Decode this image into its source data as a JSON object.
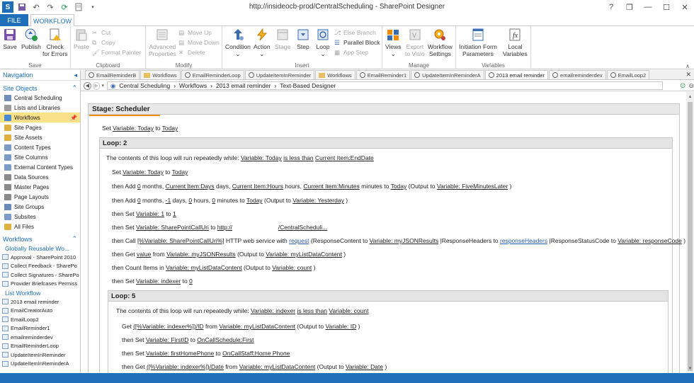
{
  "title": "http://insideocb-prod/CentralScheduling - SharePoint Designer",
  "window": {
    "help": "?",
    "restore": "❐",
    "minimize": "—",
    "maximize": "☐",
    "close": "✕"
  },
  "tabs": {
    "file": "FILE",
    "workflow": "WORKFLOW"
  },
  "ribbon": {
    "save": "Save",
    "publish": "Publish",
    "check_errors_1": "Check",
    "check_errors_2": "for Errors",
    "group_save": "Save",
    "paste": "Paste",
    "cut": "Cut",
    "copy": "Copy",
    "format_painter": "Format Painter",
    "group_clipboard": "Clipboard",
    "advanced_properties_1": "Advanced",
    "advanced_properties_2": "Properties",
    "move_up": "Move Up",
    "move_down": "Move Down",
    "delete": "Delete",
    "group_modify": "Modify",
    "condition": "Condition",
    "action": "Action",
    "stage": "Stage",
    "step": "Step",
    "loop": "Loop",
    "else_branch": "Else Branch",
    "parallel_block": "Parallel Block",
    "app_step": "App Step",
    "group_insert": "Insert",
    "views": "Views",
    "export_visio_1": "Export",
    "export_visio_2": "to Visio",
    "workflow_settings_1": "Workflow",
    "workflow_settings_2": "Settings",
    "group_manage": "Manage",
    "initiation_params_1": "Initiation Form",
    "initiation_params_2": "Parameters",
    "local_variables_1": "Local",
    "local_variables_2": "Variables",
    "group_variables": "Variables"
  },
  "nav": {
    "header": "Navigation",
    "site_objects": "Site Objects",
    "items": [
      {
        "label": "Central Scheduling",
        "color": "#6f8fb8"
      },
      {
        "label": "Lists and Libraries",
        "color": "#9a9a9a"
      },
      {
        "label": "Workflows",
        "color": "#4a8ad0"
      },
      {
        "label": "Site Pages",
        "color": "#e0b040"
      },
      {
        "label": "Site Assets",
        "color": "#e0b040"
      },
      {
        "label": "Content Types",
        "color": "#7a9cc6"
      },
      {
        "label": "Site Columns",
        "color": "#7a9cc6"
      },
      {
        "label": "External Content Types",
        "color": "#7a9cc6"
      },
      {
        "label": "Data Sources",
        "color": "#8a8a8a"
      },
      {
        "label": "Master Pages",
        "color": "#8a8a8a"
      },
      {
        "label": "Page Layouts",
        "color": "#8a8a8a"
      },
      {
        "label": "Site Groups",
        "color": "#6a8ab8"
      },
      {
        "label": "Subsites",
        "color": "#7a9cc6"
      },
      {
        "label": "All Files",
        "color": "#e0b040"
      }
    ],
    "pin": "📌",
    "workflows_section": "Workflows",
    "globally_reusable": "Globally Reusable Wo...",
    "global_items": [
      "Approval - SharePoint 2010",
      "Collect Feedback - SharePo",
      "Collect Signatures - SharePo",
      "Provider Briefcases Permiss"
    ],
    "list_workflow": "List Workflow",
    "list_items": [
      "2013 email reminder",
      "EmailCreatorAuto",
      "EmailLoop2",
      "EmailReminder1",
      "emailreminderdev",
      "EmailReminderLoop",
      "UpdateItemInReminder",
      "UpdateItemInReminderA"
    ]
  },
  "doc_tabs": [
    {
      "label": "EmailReminderB",
      "type": "wf"
    },
    {
      "label": "Workflows",
      "type": "folder"
    },
    {
      "label": "EmailReminderLoop",
      "type": "wf"
    },
    {
      "label": "UpdateItemInReminder",
      "type": "wf"
    },
    {
      "label": "Workflows",
      "type": "folder"
    },
    {
      "label": "EmailReminder1",
      "type": "wf"
    },
    {
      "label": "UpdateItemInReminderA",
      "type": "wf"
    },
    {
      "label": "2013 email reminder",
      "type": "wf",
      "active": true
    },
    {
      "label": "emailreminderdev",
      "type": "wf"
    },
    {
      "label": "EmailLoop2",
      "type": "wf"
    }
  ],
  "breadcrumb": [
    "Central Scheduling",
    "Workflows",
    "2013 email reminder",
    "Text-Based Designer"
  ],
  "designer": {
    "stage_title": "Stage: Scheduler",
    "l_set": "Set",
    "v_today": "Variable: Today",
    "l_to": "to",
    "today": "Today",
    "loop2_title": "Loop: 2",
    "loop2_desc": "The contents of this loop will run repeatedly while:",
    "is_less_than": "is less than",
    "ci_enddate": "Current Item:EndDate",
    "l_then_add": "then Add",
    "zero": "0",
    "months": "months,",
    "ci_days": "Current Item:Days",
    "days": "days,",
    "ci_hours": "Current Item:Hours",
    "hours": "hours,",
    "ci_minutes": "Current Item:Minutes",
    "minutes_to": "minutes to",
    "output_to": "(Output to",
    "v_fiveminuteslater": "Variable: FiveMinutesLater",
    "close_paren": ")",
    "minus_one": "-1",
    "v_yesterday": "Variable: Yesterday",
    "l_then_set": "then Set",
    "v_1": "Variable: 1",
    "one": "1",
    "v_spcalluri": "Variable: SharePointCallUri",
    "http": "http://",
    "central_sched": "/CentralScheduli...",
    "l_then_call": "then Call",
    "spcalluri_token": "[%Variable: SharePointCallUri%]",
    "http_web_service_with": "HTTP web service with",
    "request": "request",
    "resp_content": "(ResponseContent to",
    "v_myjsonresults": "Variable: myJSONResults",
    "resp_headers": "|ResponseHeaders to",
    "responseheaders": "responseHeaders",
    "resp_status": "|ResponseStatusCode to",
    "v_responsecode": "Variable: responseCode",
    "l_then_get": "then Get",
    "value": "value",
    "from": "from",
    "v_mylistdatacontent": "Variable: myListDataContent",
    "l_then_count": "then Count Items in",
    "v_count": "Variable: count",
    "v_indexer": "Variable: indexer",
    "loop5_title": "Loop: 5",
    "loop5_desc": "The contents of this loop will run repeatedly while:",
    "l_get": "Get",
    "indexer_id": "([%Variable: indexer%])/ID",
    "v_id": "Variable: ID",
    "v_firstid": "Variable: FirstID",
    "oncall_first": "OnCallSchedule:First",
    "v_firsthomephone": "Variable: firstHomePhone",
    "oncall_homephone": "OnCallStaff:Home Phone",
    "indexer_date": "([%Variable: indexer%])/Date",
    "v_date": "Variable: Date"
  }
}
